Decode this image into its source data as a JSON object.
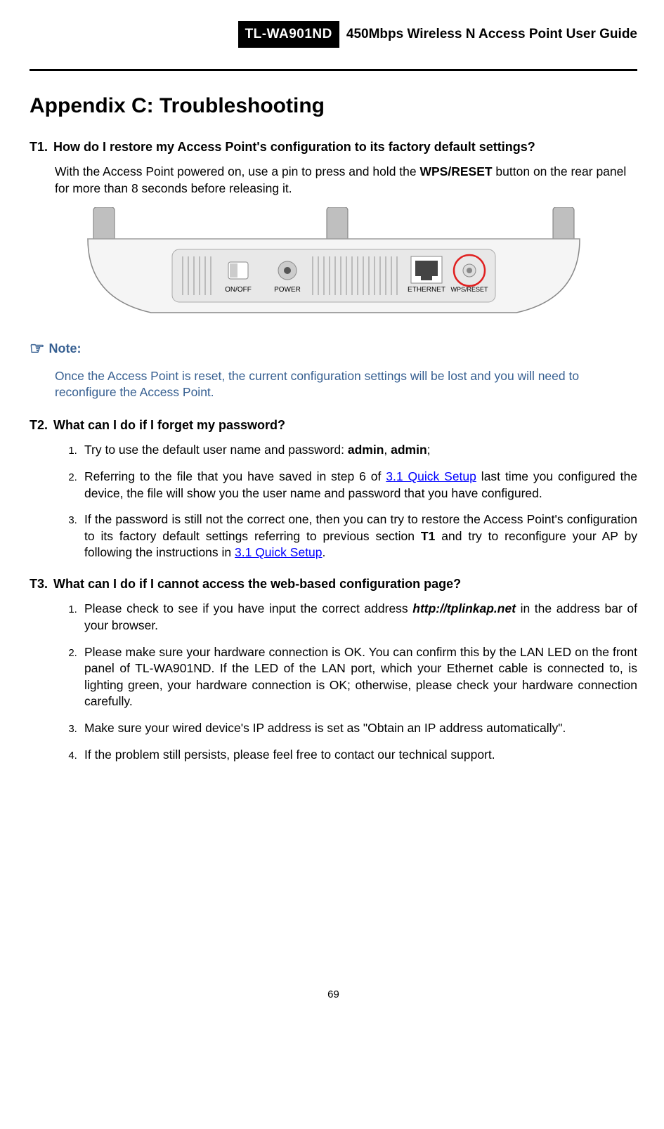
{
  "header": {
    "model": "TL-WA901ND",
    "title": "450Mbps Wireless N Access Point User Guide"
  },
  "appendix_title": "Appendix C: Troubleshooting",
  "t1": {
    "num": "T1.",
    "question": "How do I restore my Access Point's configuration to its factory default settings?",
    "intro_a": "With the Access Point powered on, use a pin to press and hold the ",
    "intro_bold": "WPS/RESET",
    "intro_b": " button on the rear panel for more than 8 seconds before releasing it."
  },
  "device": {
    "onoff": "ON/OFF",
    "power": "POWER",
    "ethernet": "ETHERNET",
    "wpsreset": "WPS/RESET"
  },
  "note": {
    "label": "Note:",
    "text": "Once the Access Point is reset, the current configuration settings will be lost and you will need to reconfigure the Access Point."
  },
  "t2": {
    "num": "T2.",
    "question": "What can I do if I forget my password?",
    "i1_a": "Try to use the default user name and password: ",
    "i1_b1": "admin",
    "i1_c": ", ",
    "i1_b2": "admin",
    "i1_d": ";",
    "i2_a": "Referring to the file that you have saved in step 6 of ",
    "i2_link": "3.1 Quick Setup",
    "i2_b": " last time you configured the device, the file will show you the user name and password that you have configured.",
    "i3_a": "If the password is still not the correct one, then you can try to restore the Access Point's configuration to its factory default settings referring to previous section ",
    "i3_bold": "T1",
    "i3_b": " and try to reconfigure your AP by following the instructions in ",
    "i3_link": "3.1 Quick Setup",
    "i3_c": "."
  },
  "t3": {
    "num": "T3.",
    "question": "What can I do if I cannot access the web-based configuration page?",
    "i1_a": "Please check to see if you have input the correct address ",
    "i1_url": "http://tplinkap.net",
    "i1_b": " in the address bar of your browser.",
    "i2": "Please make sure your hardware connection is OK. You can confirm this by the LAN LED on the front panel of TL-WA901ND. If the LED of the LAN port, which your Ethernet cable is connected to, is lighting green, your hardware connection is OK; otherwise, please check your hardware connection carefully.",
    "i3": "Make sure your wired device's IP address is set as \"Obtain an IP address automatically\".",
    "i4": "If the problem still persists, please feel free to contact our technical support."
  },
  "page_number": "69"
}
